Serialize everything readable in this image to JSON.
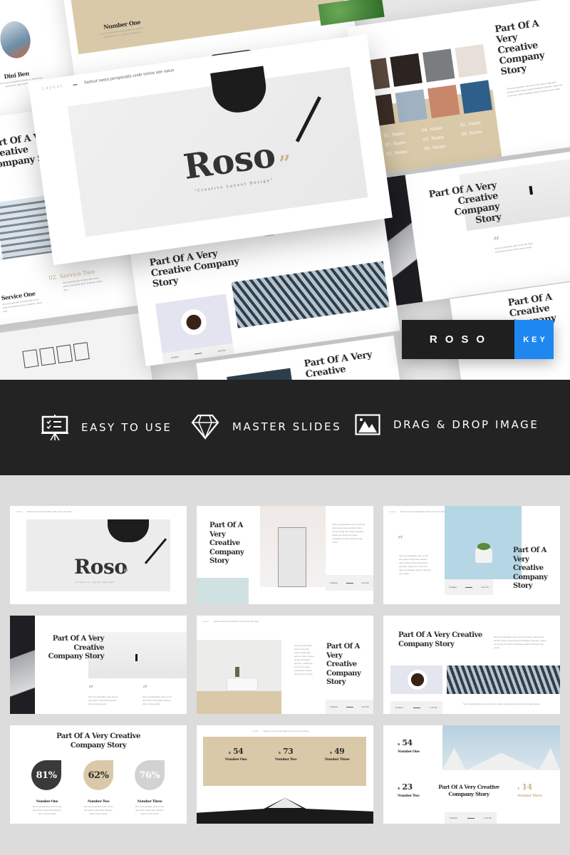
{
  "hero": {
    "main_slide": {
      "header_label": "Layout.",
      "header_text": "Sedout neeut perspiciatis unde omnis iste natus",
      "title": "Roso",
      "subtitle": "\"Creative Layout Design\"",
      "quote_mark": "”"
    },
    "profile_slide": {
      "name": "Dini Ben",
      "desc": "Sedneveciotsipstatescumlantis in doloremque laudantium, totam aperiam, eaque"
    },
    "pricing_slide": {
      "heading": "Number One",
      "desc": "Sed ut perspiciatis motrandupiate accusantium doloribade mium, itsapeam, eaque ipsa"
    },
    "team_slide": {
      "title": "Part Of A Very Creative Company Story",
      "names": [
        "01. Name",
        "02. Name",
        "03. Name",
        "04. Name",
        "05. Name",
        "06. Name",
        "07. Name",
        "08. Name"
      ],
      "body": "Sed ut perspiciatis unde omnis iste natus volupt atea santium dolor emque lauda ntiumtatem aperiam, eaque ips omnis iste natus voluptatea santium dolorem que volupt"
    },
    "story_slide": {
      "title": "Part Of A Very Creative Company Story",
      "body": "Sed ut perspiciatis unde omnis iste natus volupt atea santium dolor emque lauda ntiumtatem aperiam, eaque ips omnis iste natus voluptatea santium dolorem que volupt atea santium, eaque ips unde voluptatea",
      "info": [
        "Creative",
        "Loft Jon"
      ]
    },
    "left_slide": {
      "title": "Part Of A Very Creative Company Story"
    },
    "walker_slide": {
      "title": "Part Of A Very Creative Company Story",
      "quote_text": "Sed ut perspiciatis unde omnis iste natus volupt atea santium dolor emque lauda"
    },
    "service_slide": {
      "service_one": "Service One",
      "service_two_num": "02.",
      "service_two": "Service Two",
      "desc": "Sed ut perspiciatis nmeeds plate accus antium doloriauda ntium, itsapeam, eaque ipsa"
    },
    "bottom_slide": {
      "title": "Part Of A Very Creative"
    },
    "right_edge_slide": {
      "title": "Part Of A Creative Company Story"
    },
    "badge": {
      "name": "ROSO",
      "format": "KEY"
    }
  },
  "banner": {
    "features": [
      {
        "icon": "presentation-board-icon",
        "label": "EASY TO USE"
      },
      {
        "icon": "diamond-icon",
        "label": "MASTER SLIDES"
      },
      {
        "icon": "image-icon",
        "label": "DRAG & DROP IMAGE"
      }
    ]
  },
  "grid": {
    "header_label": "Layout.",
    "header_text": "Sedout neeut perspiciatis unde omnis iste natus",
    "lorem_short": "Sed ut perspiciatis unde omnis iste natus volupt atea santium dolor emque lauda",
    "lorem_long": "Sed ut perspiciatis unde omnis iste natus volupt atea santium dolor emque lauda ntiumtatem aperiam, eaque ips omnis iste natus voluptatea santium dolorem que volupt",
    "info": [
      "Creative",
      "Loft Jon"
    ],
    "cards": {
      "c1": {
        "title": "Roso",
        "subtitle": "\"Creative Layout Design\""
      },
      "c2": {
        "title": "Part Of A Very Creative Company Story"
      },
      "c3": {
        "title": "Part Of A Very Creative Company Story"
      },
      "c4": {
        "title": "Part Of A Very Creative Company Story"
      },
      "c5": {
        "title": "Part Of A Very Creative Company Story"
      },
      "c6": {
        "title": "Part Of A Very Creative Company Story"
      },
      "c7": {
        "title": "Part Of A Very Creative Company Story",
        "stats": [
          {
            "value": "81%",
            "label": "Number One",
            "color": "#3a3a3a"
          },
          {
            "value": "62%",
            "label": "Number Two",
            "color": "#d9c9a8"
          },
          {
            "value": "76%",
            "label": "Number Three",
            "color": "#d2d2d2"
          }
        ]
      },
      "c8": {
        "prices": [
          {
            "value": "54",
            "currency": "$",
            "label": "Number One"
          },
          {
            "value": "73",
            "currency": "$",
            "label": "Number Two"
          },
          {
            "value": "49",
            "currency": "$",
            "label": "Number Three"
          }
        ]
      },
      "c9": {
        "title": "Part Of A Very Creative Company Story",
        "prices": [
          {
            "value": "54",
            "currency": "$",
            "label": "Number One"
          },
          {
            "value": "23",
            "currency": "$",
            "label": "Number Two"
          },
          {
            "value": "14",
            "currency": "$",
            "label": "Number Three"
          }
        ]
      }
    }
  },
  "colors": {
    "accent_beige": "#d9c9a8",
    "dark": "#232323",
    "key_blue": "#1e88f0",
    "title_text": "#2e2e2e"
  }
}
